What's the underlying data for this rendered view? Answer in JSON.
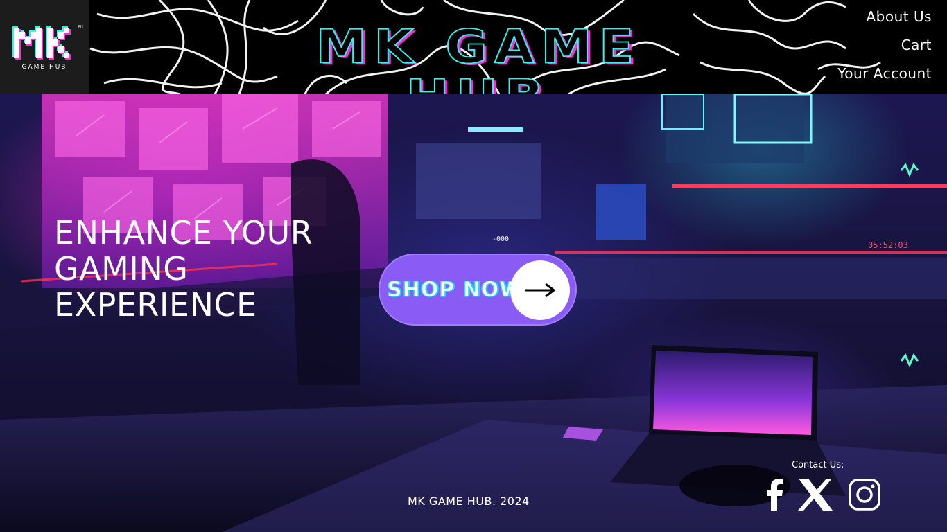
{
  "header": {
    "logo_text": "MK",
    "logo_sub": "GAME HUB",
    "logo_pm": "PH",
    "title": "MK GAME HUB",
    "nav": [
      {
        "label": "About Us"
      },
      {
        "label": "Cart"
      },
      {
        "label": "Your Account"
      }
    ]
  },
  "hero": {
    "headline": [
      "ENHANCE YOUR",
      "GAMING",
      "EXPERIENCE"
    ],
    "cta_label": "SHOP NOW",
    "cta_icon": "arrow-right-icon",
    "clock_text": "05:52:03",
    "monitor_text": "-000"
  },
  "footer": {
    "copyright": "MK GAME HUB. 2024",
    "contact_label": "Contact Us:",
    "socials": [
      {
        "name": "facebook-icon"
      },
      {
        "name": "x-icon"
      },
      {
        "name": "instagram-icon"
      }
    ]
  },
  "colors": {
    "title_fill": "#000000",
    "title_stroke": "#2ff4ee",
    "title_shadow": "#ff2bd6",
    "cta_bg": "#8a5cf5",
    "header_bg": "#000000"
  }
}
